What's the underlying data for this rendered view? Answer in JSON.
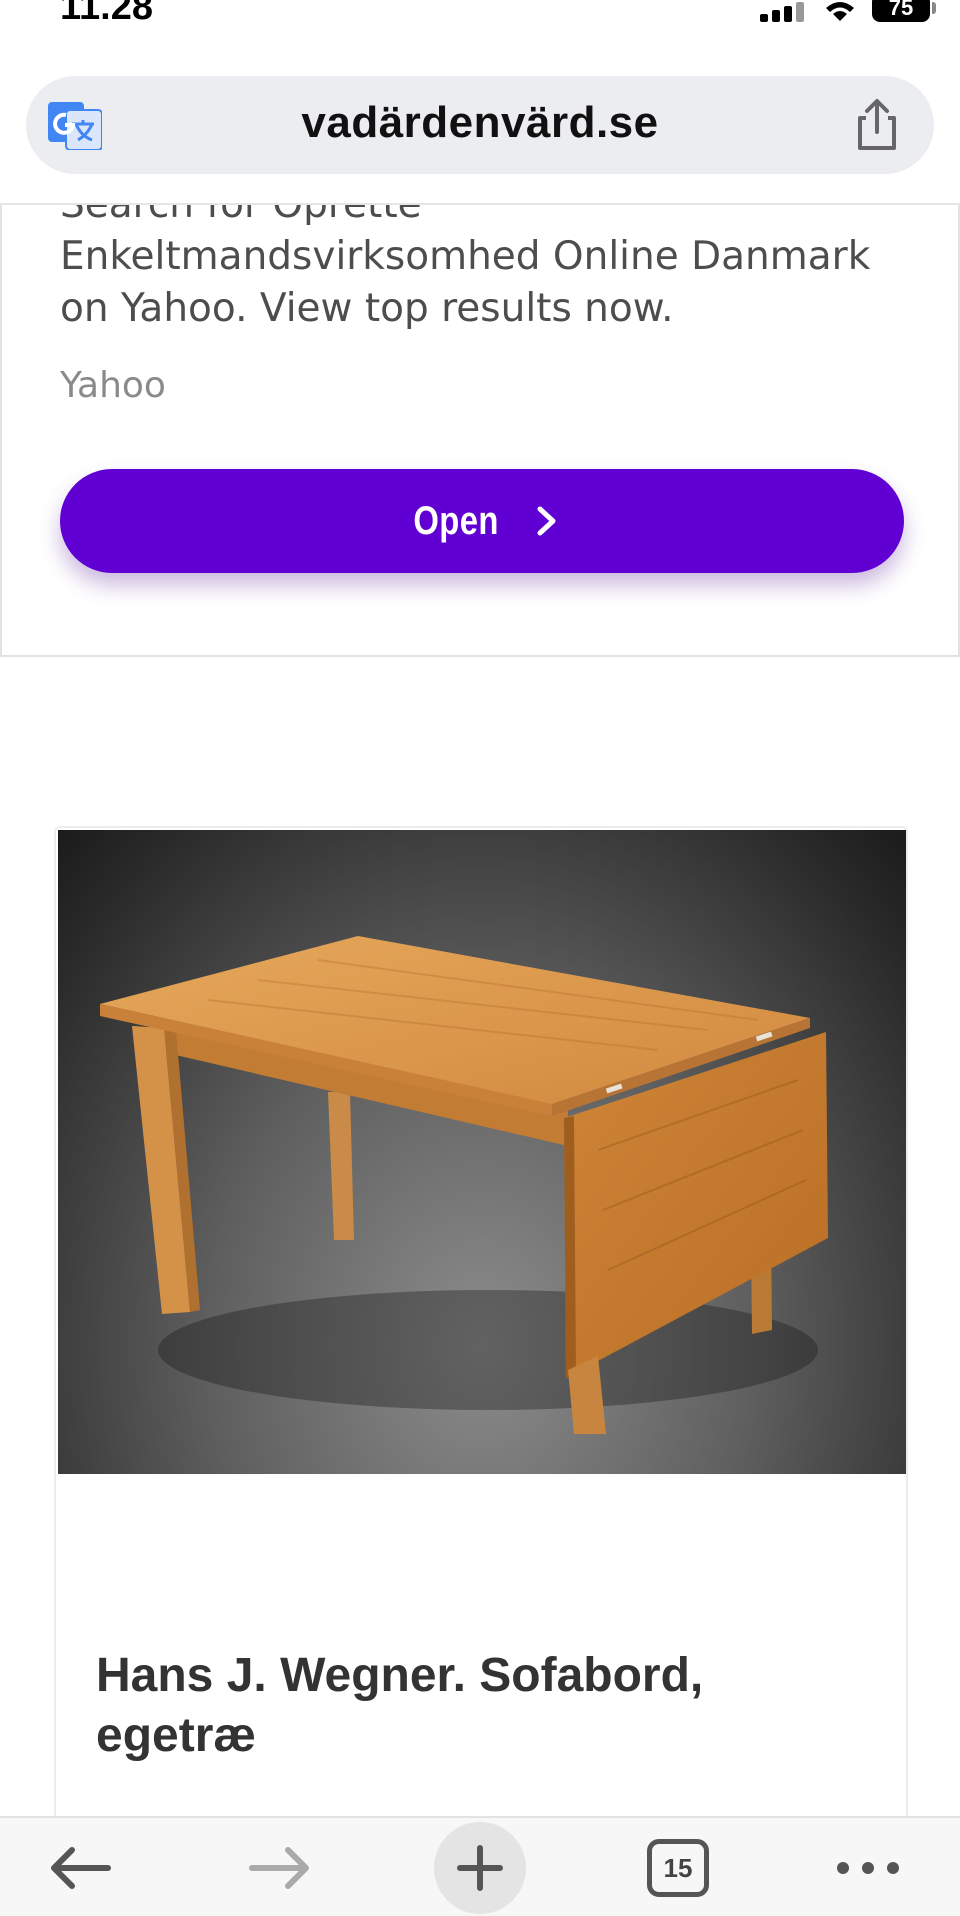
{
  "status_bar": {
    "time": "11.28",
    "battery": "75"
  },
  "url_bar": {
    "domain": "vadärdenvärd.se",
    "translate_icon": "translate-icon",
    "share_icon": "share-icon"
  },
  "ad": {
    "text_line_cut": "Search for Oprette",
    "text_line_2": "Enkeltmandsvirksomhed Online Danmark",
    "text_line_3": "on Yahoo. View top results now.",
    "source": "Yahoo",
    "button_label": "Open",
    "accent_color": "#6100d2"
  },
  "product": {
    "image_icon": "coffee-table-photo",
    "title": "Hans J. Wegner. Sofabord, egetræ"
  },
  "toolbar": {
    "back_icon": "back-arrow-icon",
    "forward_icon": "forward-arrow-icon",
    "new_tab_icon": "plus-icon",
    "tab_count": "15",
    "more_icon": "more-dots-icon"
  }
}
